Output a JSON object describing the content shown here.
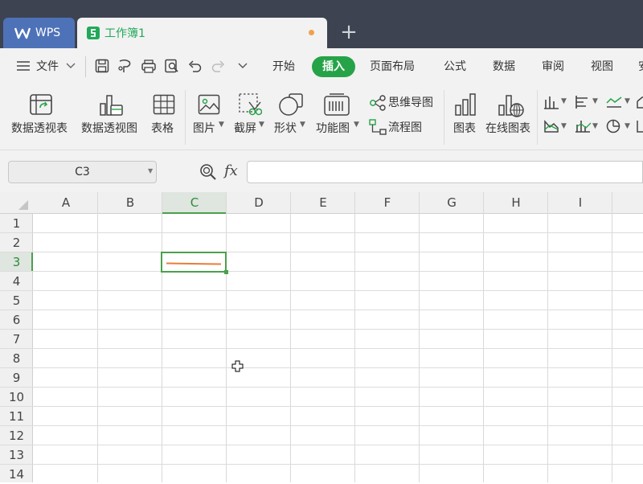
{
  "title_bar": {
    "app_tab_label": "WPS",
    "workbook_tab_label": "工作簿1",
    "colors": {
      "bar": "#3d4350",
      "app_tab": "#4e72b8",
      "accent": "#26a348",
      "unsaved_dot": "#f0a24a"
    }
  },
  "menu": {
    "file_label": "文件",
    "tabs": [
      {
        "label": "开始"
      },
      {
        "label": "插入",
        "active": true
      },
      {
        "label": "页面布局"
      },
      {
        "label": "公式"
      },
      {
        "label": "数据"
      },
      {
        "label": "审阅"
      },
      {
        "label": "视图"
      },
      {
        "label": "安"
      }
    ]
  },
  "ribbon": {
    "pivot_table": "数据透视表",
    "pivot_chart": "数据透视图",
    "table": "表格",
    "picture": "图片",
    "screenshot": "截屏",
    "shape": "形状",
    "function_chart": "功能图",
    "mind_map": "思维导图",
    "flowchart": "流程图",
    "chart": "图表",
    "online_chart": "在线图表"
  },
  "formula_bar": {
    "name_box": "C3",
    "fx_label": "fx",
    "formula_value": ""
  },
  "grid": {
    "columns": [
      "A",
      "B",
      "C",
      "D",
      "E",
      "F",
      "G",
      "H",
      "I"
    ],
    "rows": [
      "1",
      "2",
      "3",
      "4",
      "5",
      "6",
      "7",
      "8",
      "9",
      "10",
      "11",
      "12",
      "13",
      "14"
    ],
    "selected_cell": "C3",
    "selected_color": "#4aa14a"
  }
}
